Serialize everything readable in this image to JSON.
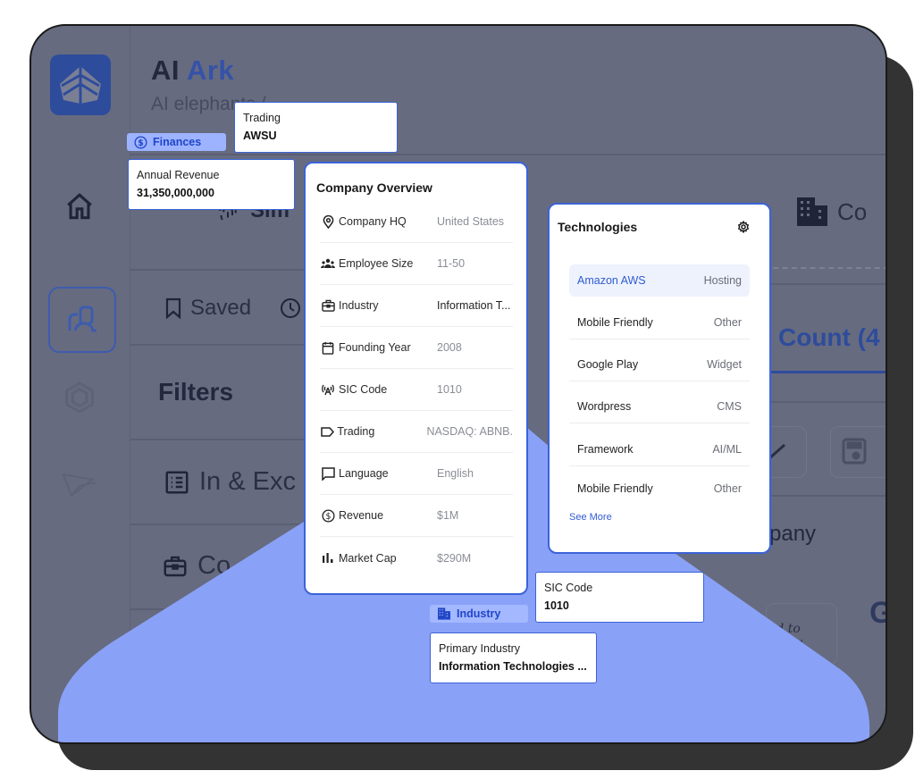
{
  "app": {
    "brand_prefix": "AI",
    "brand_suffix": "Ark",
    "breadcrumb": "AI elephants /",
    "colors": {
      "accent": "#3b63d8",
      "brand_dark": "#2e4c9c",
      "overlay": "#666b80",
      "highlight_wedge": "#8aa1f8",
      "chip_bg": "#9db3ff"
    }
  },
  "background": {
    "sim_label": "Sim",
    "company_tab_label": "Co",
    "saved_label": "Saved",
    "filters_heading": "Filters",
    "include_exclude_label": "In & Exc",
    "company_filter_label": "Co",
    "count_tab_label": "Count (4",
    "company_col_label": "pany",
    "company_initial": "G",
    "logo_signature": "ed to Grow"
  },
  "finances_chip": {
    "label": "Finances",
    "icon": "dollar-circle-icon"
  },
  "trading_card": {
    "label": "Trading",
    "value": "AWSU"
  },
  "revenue_card": {
    "label": "Annual Revenue",
    "value": "31,350,000,000"
  },
  "overview": {
    "title": "Company Overview",
    "rows": [
      {
        "icon": "location-pin-icon",
        "key": "Company HQ",
        "value": "United States",
        "emphasis": false
      },
      {
        "icon": "team-icon",
        "key": "Employee Size",
        "value": "11-50",
        "emphasis": false
      },
      {
        "icon": "briefcase-icon",
        "key": "Industry",
        "value": "Information T...",
        "emphasis": true
      },
      {
        "icon": "calendar-icon",
        "key": "Founding Year",
        "value": "2008",
        "emphasis": false
      },
      {
        "icon": "antenna-icon",
        "key": "SIC Code",
        "value": "1010",
        "emphasis": false
      },
      {
        "icon": "tag-icon",
        "key": "Trading",
        "value": "NASDAQ: ABNB.",
        "emphasis": false
      },
      {
        "icon": "chat-icon",
        "key": "Language",
        "value": "English",
        "emphasis": false
      },
      {
        "icon": "dollar-circle-icon",
        "key": "Revenue",
        "value": "$1M",
        "emphasis": false
      },
      {
        "icon": "bar-chart-icon",
        "key": "Market Cap",
        "value": "$290M",
        "emphasis": false
      }
    ]
  },
  "technologies": {
    "title": "Technologies",
    "settings_icon": "gear-icon",
    "rows": [
      {
        "name": "Amazon AWS",
        "category": "Hosting",
        "selected": true
      },
      {
        "name": "Mobile Friendly",
        "category": "Other",
        "selected": false
      },
      {
        "name": "Google Play",
        "category": "Widget",
        "selected": false
      },
      {
        "name": "Wordpress",
        "category": "CMS",
        "selected": false
      },
      {
        "name": "Framework",
        "category": "AI/ML",
        "selected": false
      },
      {
        "name": "Mobile Friendly",
        "category": "Other",
        "selected": false
      }
    ],
    "see_more_label": "See More"
  },
  "industry_chip": {
    "label": "Industry",
    "icon": "building-icon"
  },
  "sic_card": {
    "label": "SIC Code",
    "value": "1010"
  },
  "primary_industry_card": {
    "label": "Primary Industry",
    "value": "Information Technologies ..."
  }
}
